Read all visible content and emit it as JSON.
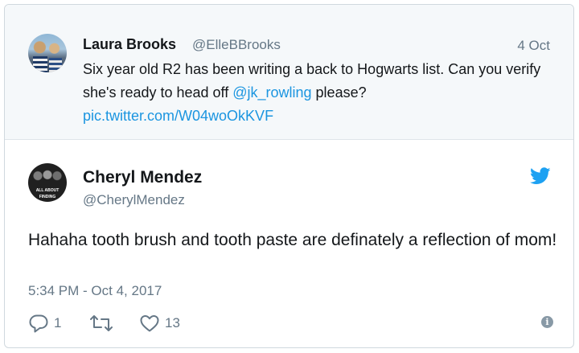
{
  "parent_tweet": {
    "name": "Laura Brooks",
    "handle": "@ElleBBrooks",
    "date": "4 Oct",
    "text_before_mention": "Six year old R2 has been writing a back to Hogwarts list. Can you verify she's ready to head off ",
    "mention": "@jk_rowling",
    "text_after_mention": " please?",
    "pic_link": "pic.twitter.com/W04woOkKVF"
  },
  "main_tweet": {
    "name": "Cheryl Mendez",
    "handle": "@CherylMendez",
    "avatar_text": "ALL ABOUT FINDING",
    "text": "Hahaha tooth brush and tooth paste are definately a reflection of mom!",
    "timestamp": "5:34 PM - Oct 4, 2017",
    "reply_count": "1",
    "retweet_count": "",
    "like_count": "13"
  },
  "colors": {
    "link": "#1b95e0",
    "twitter_blue": "#1da1f2",
    "muted": "#657786",
    "parent_bg": "#f5f8fa"
  },
  "icons": [
    "reply-icon",
    "retweet-icon",
    "like-icon",
    "info-icon",
    "twitter-bird-icon"
  ]
}
